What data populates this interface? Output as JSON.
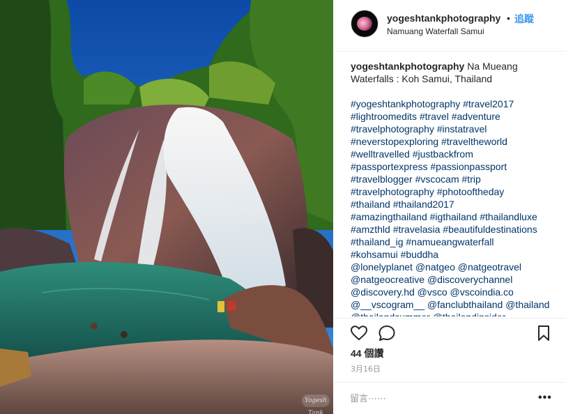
{
  "post": {
    "photo_watermark": "Yogesh Tank",
    "header": {
      "username": "yogeshtankphotography",
      "separator": "•",
      "follow_label": "追蹤",
      "location": "Namuang Waterfall Samui"
    },
    "caption": {
      "username": "yogeshtankphotography",
      "text_line1": " Na Mueang",
      "text_line2": "Waterfalls : Koh Samui, Thailand",
      "tag_lines": [
        "#yogeshtankphotography #travel2017",
        "#lightroomedits #travel #adventure",
        "#travelphotography #instatravel",
        "#neverstopexploring #traveltheworld",
        "#welltravelled #justbackfrom",
        "#passportexpress #passionpassport",
        "#travelblogger #vscocam #trip",
        "#travelphotography #photooftheday",
        "#thailand #thailand2017",
        "#amazingthailand #igthailand #thailandluxe",
        "#amzthld #travelasia #beautifuldestinations",
        "#thailand_ig #namueangwaterfall",
        "#kohsamui #buddha",
        "@lonelyplanet @natgeo @natgeotravel",
        "@natgeocreative @discoverychannel",
        "@discovery.hd @vsco @vscoindia.co",
        "@__vscogram__ @fanclubthailand @thailand",
        "@thailandsummer @thailandinsider"
      ]
    },
    "actions": {
      "like_icon": "heart-outline-icon",
      "comment_icon": "speech-bubble-icon",
      "save_icon": "bookmark-icon"
    },
    "likes_label": "44 個讚",
    "date_label": "3月16日",
    "comment": {
      "placeholder": "留言⋯⋯",
      "more_label": "•••"
    }
  }
}
